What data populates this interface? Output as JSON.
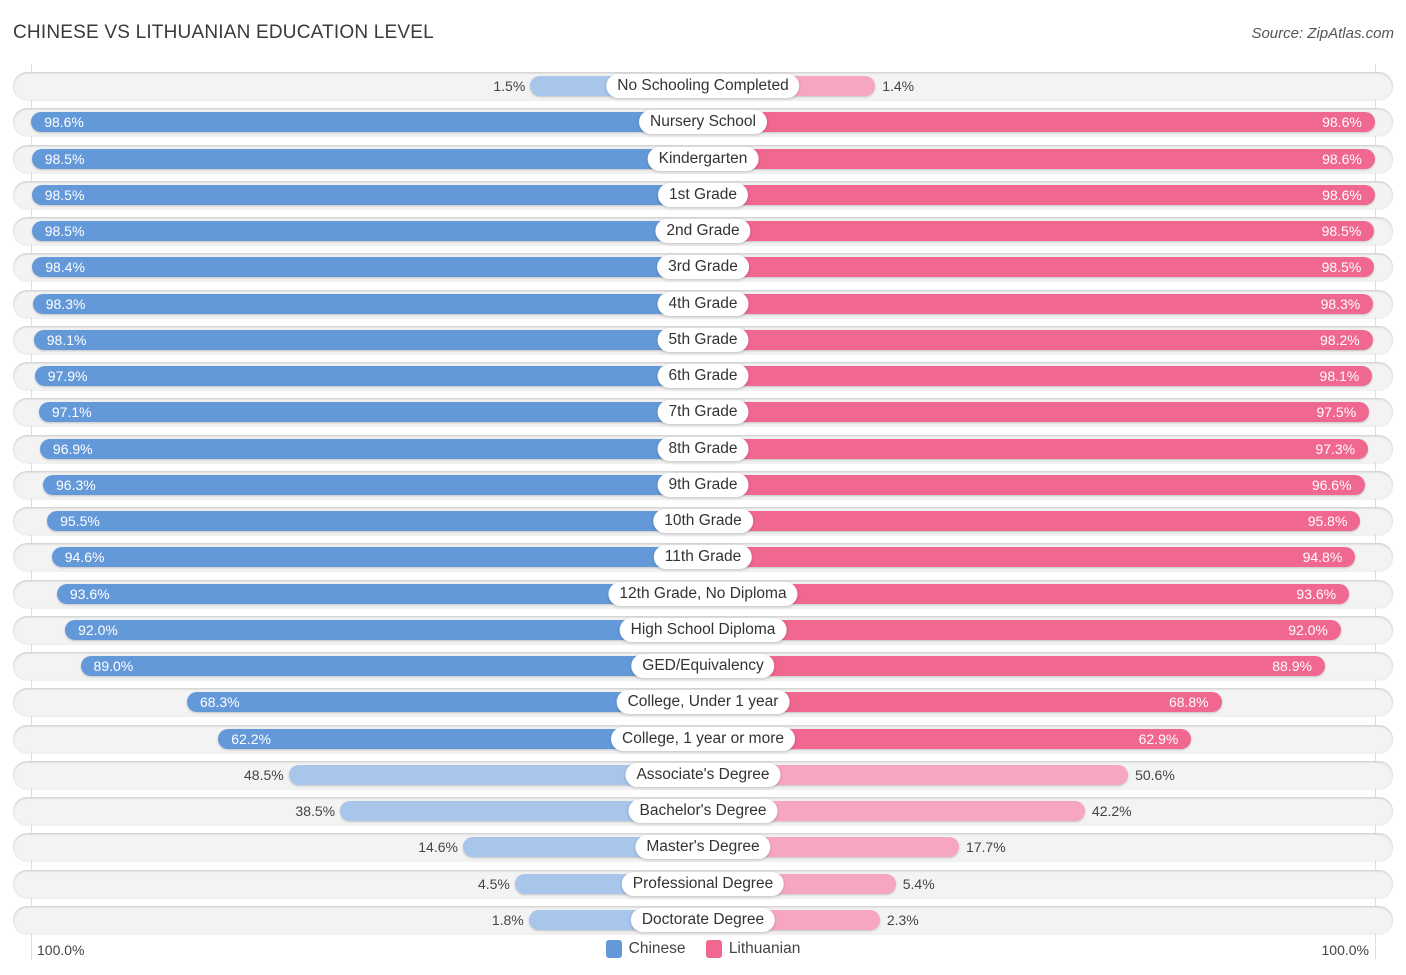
{
  "header": {
    "title": "CHINESE VS LITHUANIAN EDUCATION LEVEL",
    "source": "Source: ZipAtlas.com"
  },
  "colors": {
    "chinese": "#6499d9",
    "chinese_light": "#a7c6ea",
    "lithuanian": "#f06790",
    "lithuanian_light": "#f6a7bf"
  },
  "chart_data": {
    "type": "bar",
    "orientation": "horizontal-diverging",
    "title": "CHINESE VS LITHUANIAN EDUCATION LEVEL",
    "xlabel": "",
    "ylabel": "",
    "xlim": [
      0,
      100
    ],
    "axis_left_label": "100.0%",
    "axis_right_label": "100.0%",
    "legend_position": "bottom-center",
    "categories": [
      "No Schooling Completed",
      "Nursery School",
      "Kindergarten",
      "1st Grade",
      "2nd Grade",
      "3rd Grade",
      "4th Grade",
      "5th Grade",
      "6th Grade",
      "7th Grade",
      "8th Grade",
      "9th Grade",
      "10th Grade",
      "11th Grade",
      "12th Grade, No Diploma",
      "High School Diploma",
      "GED/Equivalency",
      "College, Under 1 year",
      "College, 1 year or more",
      "Associate's Degree",
      "Bachelor's Degree",
      "Master's Degree",
      "Professional Degree",
      "Doctorate Degree"
    ],
    "series": [
      {
        "name": "Chinese",
        "side": "left",
        "values": [
          1.5,
          98.6,
          98.5,
          98.5,
          98.5,
          98.4,
          98.3,
          98.1,
          97.9,
          97.1,
          96.9,
          96.3,
          95.5,
          94.6,
          93.6,
          92.0,
          89.0,
          68.3,
          62.2,
          48.5,
          38.5,
          14.6,
          4.5,
          1.8
        ],
        "labels": [
          "1.5%",
          "98.6%",
          "98.5%",
          "98.5%",
          "98.5%",
          "98.4%",
          "98.3%",
          "98.1%",
          "97.9%",
          "97.1%",
          "96.9%",
          "96.3%",
          "95.5%",
          "94.6%",
          "93.6%",
          "92.0%",
          "89.0%",
          "68.3%",
          "62.2%",
          "48.5%",
          "38.5%",
          "14.6%",
          "4.5%",
          "1.8%"
        ]
      },
      {
        "name": "Lithuanian",
        "side": "right",
        "values": [
          1.4,
          98.6,
          98.6,
          98.6,
          98.5,
          98.5,
          98.3,
          98.2,
          98.1,
          97.5,
          97.3,
          96.6,
          95.8,
          94.8,
          93.6,
          92.0,
          88.9,
          68.8,
          62.9,
          50.6,
          42.2,
          17.7,
          5.4,
          2.3
        ],
        "labels": [
          "1.4%",
          "98.6%",
          "98.6%",
          "98.6%",
          "98.5%",
          "98.5%",
          "98.3%",
          "98.2%",
          "98.1%",
          "97.5%",
          "97.3%",
          "96.6%",
          "95.8%",
          "94.8%",
          "93.6%",
          "92.0%",
          "88.9%",
          "68.8%",
          "62.9%",
          "50.6%",
          "42.2%",
          "17.7%",
          "5.4%",
          "2.3%"
        ]
      }
    ]
  },
  "legend": {
    "items": [
      {
        "label": "Chinese"
      },
      {
        "label": "Lithuanian"
      }
    ]
  }
}
